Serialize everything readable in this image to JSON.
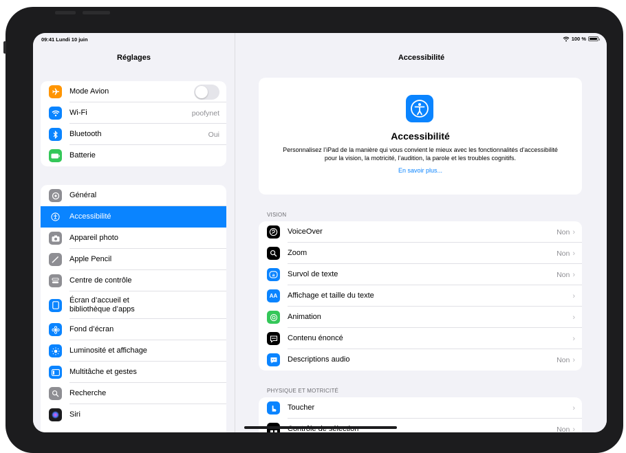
{
  "status": {
    "time": "09:41",
    "date": "Lundi 10 juin",
    "battery": "100 %"
  },
  "sidebar": {
    "title": "Réglages",
    "group1": [
      {
        "label": "Mode Avion",
        "icon": "airplane-icon",
        "color": "#ff9500",
        "toggle": false
      },
      {
        "label": "Wi-Fi",
        "icon": "wifi-icon",
        "color": "#0a84ff",
        "value": "poofynet"
      },
      {
        "label": "Bluetooth",
        "icon": "bluetooth-icon",
        "color": "#0a84ff",
        "value": "Oui"
      },
      {
        "label": "Batterie",
        "icon": "battery-icon",
        "color": "#34c759"
      }
    ],
    "group2": [
      {
        "label": "Général",
        "icon": "gear-icon",
        "color": "#8e8e93"
      },
      {
        "label": "Accessibilité",
        "icon": "accessibility-icon",
        "color": "#0a84ff",
        "selected": true
      },
      {
        "label": "Appareil photo",
        "icon": "camera-icon",
        "color": "#8e8e93"
      },
      {
        "label": "Apple Pencil",
        "icon": "pencil-icon",
        "color": "#8e8e93"
      },
      {
        "label": "Centre de contrôle",
        "icon": "control-center-icon",
        "color": "#8e8e93"
      },
      {
        "label": "Écran d’accueil et bibliothèque d’apps",
        "icon": "home-screen-icon",
        "color": "#0a84ff",
        "tall": true
      },
      {
        "label": "Fond d’écran",
        "icon": "wallpaper-icon",
        "color": "#0a84ff"
      },
      {
        "label": "Luminosité et affichage",
        "icon": "brightness-icon",
        "color": "#0a84ff"
      },
      {
        "label": "Multitâche et gestes",
        "icon": "multitask-icon",
        "color": "#0a84ff"
      },
      {
        "label": "Recherche",
        "icon": "search-icon",
        "color": "#8e8e93"
      },
      {
        "label": "Siri",
        "icon": "siri-icon",
        "color": "#1c1c1e"
      }
    ]
  },
  "detail": {
    "title": "Accessibilité",
    "hero": {
      "title": "Accessibilité",
      "description": "Personnalisez l’iPad de la manière qui vous convient le mieux avec les fonctionnalités d’accessibilité pour la vision, la motricité, l’audition, la parole et les troubles cognitifs.",
      "link": "En savoir plus..."
    },
    "vision_header": "VISION",
    "vision": [
      {
        "label": "VoiceOver",
        "icon": "voiceover-icon",
        "color": "#000000",
        "value": "Non"
      },
      {
        "label": "Zoom",
        "icon": "zoom-icon",
        "color": "#000000",
        "value": "Non"
      },
      {
        "label": "Survol de texte",
        "icon": "hover-text-icon",
        "color": "#0a84ff",
        "value": "Non"
      },
      {
        "label": "Affichage et taille du texte",
        "icon": "text-size-icon",
        "color": "#0a84ff",
        "value": ""
      },
      {
        "label": "Animation",
        "icon": "motion-icon",
        "color": "#34c759",
        "value": ""
      },
      {
        "label": "Contenu énoncé",
        "icon": "spoken-content-icon",
        "color": "#000000",
        "value": ""
      },
      {
        "label": "Descriptions audio",
        "icon": "audio-descriptions-icon",
        "color": "#0a84ff",
        "value": "Non"
      }
    ],
    "physical_header": "PHYSIQUE ET MOTRICITÉ",
    "physical": [
      {
        "label": "Toucher",
        "icon": "touch-icon",
        "color": "#0a84ff",
        "value": ""
      },
      {
        "label": "Contrôle de sélection",
        "icon": "switch-control-icon",
        "color": "#000000",
        "value": "Non"
      }
    ]
  }
}
